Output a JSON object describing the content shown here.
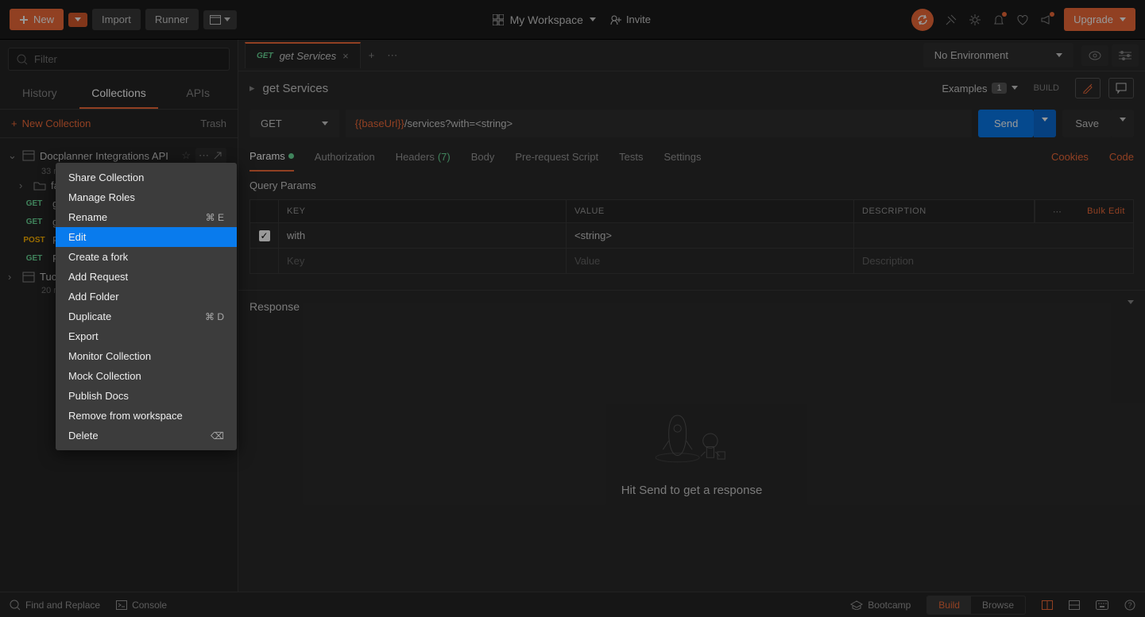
{
  "topbar": {
    "new": "New",
    "import": "Import",
    "runner": "Runner",
    "workspace": "My Workspace",
    "invite": "Invite",
    "upgrade": "Upgrade"
  },
  "sidebar": {
    "filter_placeholder": "Filter",
    "tabs": {
      "history": "History",
      "collections": "Collections",
      "apis": "APIs"
    },
    "new_collection": "New Collection",
    "trash": "Trash",
    "collections": [
      {
        "name": "Docplanner Integrations API",
        "subtitle": "33 r",
        "expanded": true
      },
      {
        "name": "Tuc",
        "subtitle": "20 r",
        "expanded": false
      }
    ],
    "folders": [
      {
        "name": "fa"
      }
    ],
    "requests": [
      {
        "method": "GET",
        "name": "ge"
      },
      {
        "method": "GET",
        "name": "ge"
      },
      {
        "method": "POST",
        "name": "Pu"
      },
      {
        "method": "GET",
        "name": "Pl"
      }
    ]
  },
  "content": {
    "tab": {
      "method": "GET",
      "title": "get Services"
    },
    "request_title": "get Services",
    "examples_label": "Examples",
    "examples_count": "1",
    "build_label": "BUILD",
    "method": "GET",
    "url_prefix": "{{baseUrl}}",
    "url_path": "/services?with=<string>",
    "send": "Send",
    "save": "Save",
    "env_none": "No Environment",
    "param_tabs": {
      "params": "Params",
      "authorization": "Authorization",
      "headers": "Headers",
      "headers_count": "(7)",
      "body": "Body",
      "pre_request": "Pre-request Script",
      "tests": "Tests",
      "settings": "Settings",
      "cookies": "Cookies",
      "code": "Code"
    },
    "query_params_label": "Query Params",
    "param_headers": {
      "key": "KEY",
      "value": "VALUE",
      "description": "DESCRIPTION",
      "bulk": "Bulk Edit"
    },
    "params": [
      {
        "checked": true,
        "key": "with",
        "value": "<string>",
        "description": ""
      }
    ],
    "placeholder": {
      "key": "Key",
      "value": "Value",
      "description": "Description"
    },
    "response_title": "Response",
    "response_empty": "Hit Send to get a response"
  },
  "footer": {
    "find_replace": "Find and Replace",
    "console": "Console",
    "bootcamp": "Bootcamp",
    "build": "Build",
    "browse": "Browse"
  },
  "ctx_menu": {
    "share": "Share Collection",
    "manage_roles": "Manage Roles",
    "rename": "Rename",
    "rename_sc": "⌘ E",
    "edit": "Edit",
    "create_fork": "Create a fork",
    "add_request": "Add Request",
    "add_folder": "Add Folder",
    "duplicate": "Duplicate",
    "duplicate_sc": "⌘ D",
    "export": "Export",
    "monitor": "Monitor Collection",
    "mock": "Mock Collection",
    "publish": "Publish Docs",
    "remove": "Remove from workspace",
    "delete": "Delete"
  }
}
